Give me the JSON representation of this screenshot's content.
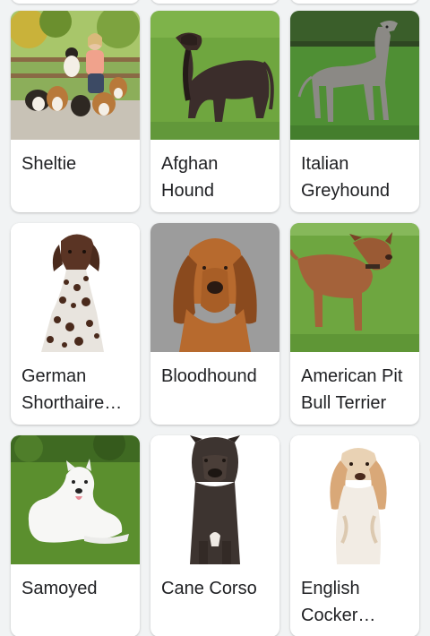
{
  "results": [
    {
      "label": "Sheltie",
      "image": "sheltie-photo",
      "bg": "#7fa255"
    },
    {
      "label": "Afghan Hound",
      "image": "afghan-hound-photo",
      "bg": "#6ea83e"
    },
    {
      "label": "Italian Greyhound",
      "image": "italian-greyhound-photo",
      "bg": "#4e8f33"
    },
    {
      "label": "German Shorthaired Pointer",
      "image": "german-shorthaired-pointer-photo",
      "bg": "#ffffff"
    },
    {
      "label": "Bloodhound",
      "image": "bloodhound-photo",
      "bg": "#9a9a9a"
    },
    {
      "label": "American Pit Bull Terrier",
      "image": "american-pit-bull-terrier-photo",
      "bg": "#6fa640"
    },
    {
      "label": "Samoyed",
      "image": "samoyed-photo",
      "bg": "#5b8f2e"
    },
    {
      "label": "Cane Corso",
      "image": "cane-corso-photo",
      "bg": "#ffffff"
    },
    {
      "label": "English Cocker Spaniel",
      "image": "english-cocker-spaniel-photo",
      "bg": "#ffffff"
    }
  ]
}
